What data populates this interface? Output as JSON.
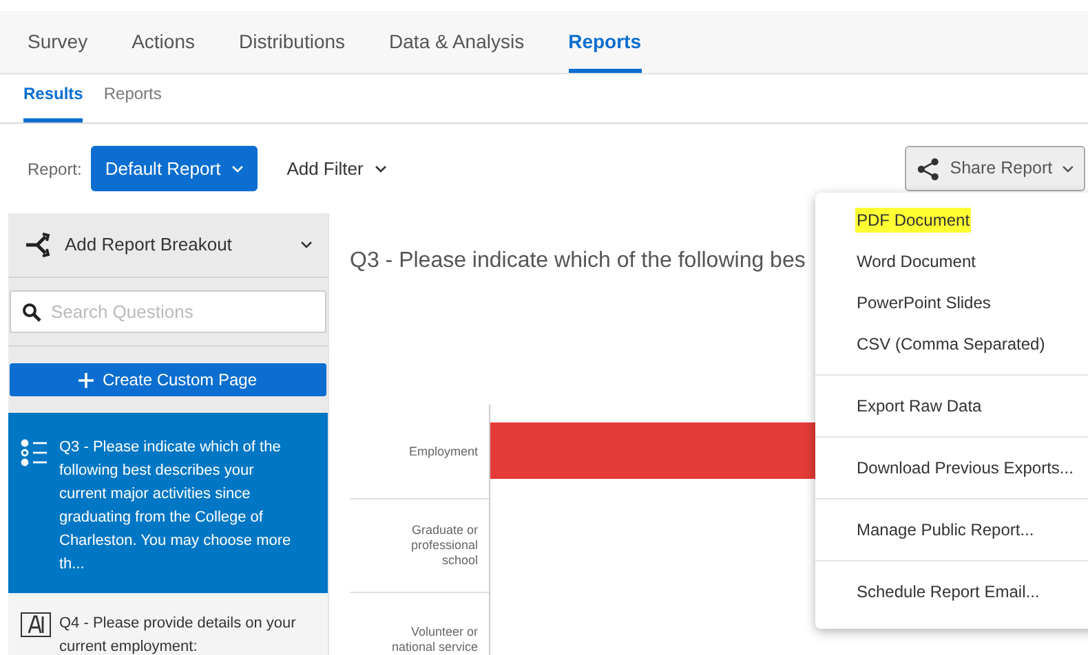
{
  "nav_tabs": [
    {
      "label": "Survey",
      "selected": false
    },
    {
      "label": "Actions",
      "selected": false
    },
    {
      "label": "Distributions",
      "selected": false
    },
    {
      "label": "Data & Analysis",
      "selected": false
    },
    {
      "label": "Reports",
      "selected": true
    }
  ],
  "sub_tabs": [
    {
      "label": "Results",
      "selected": true
    },
    {
      "label": "Reports",
      "selected": false
    }
  ],
  "toolbar": {
    "report_label": "Report:",
    "report_button": "Default Report",
    "filter_button": "Add Filter",
    "share_button": "Share Report"
  },
  "sidebar": {
    "breakout": "Add Report Breakout",
    "search": {
      "placeholder": "Search Questions"
    },
    "create_button": "Create Custom Page",
    "questions": [
      {
        "kind": "choice",
        "text": "Q3 - Please indicate which of the following best describes your current major activities since graduating from the College of Charleston. You may choose more th...",
        "selected": true
      },
      {
        "kind": "text",
        "text": "Q4 - Please provide details on your current employment:",
        "selected": false
      }
    ]
  },
  "main": {
    "title": "Q3 - Please indicate which of the following bes",
    "categories": [
      "Employment",
      "Graduate or professional school",
      "Volunteer or national service"
    ]
  },
  "share_menu": {
    "groups": [
      [
        {
          "label": "PDF Document",
          "highlighted": true
        },
        {
          "label": "Word Document",
          "highlighted": false
        },
        {
          "label": "PowerPoint Slides",
          "highlighted": false
        },
        {
          "label": "CSV (Comma Separated)",
          "highlighted": false
        }
      ],
      [
        {
          "label": "Export Raw Data",
          "highlighted": false
        }
      ],
      [
        {
          "label": "Download Previous Exports...",
          "highlighted": false
        }
      ],
      [
        {
          "label": "Manage Public Report...",
          "highlighted": false
        }
      ],
      [
        {
          "label": "Schedule Report Email...",
          "highlighted": false
        }
      ]
    ]
  }
}
